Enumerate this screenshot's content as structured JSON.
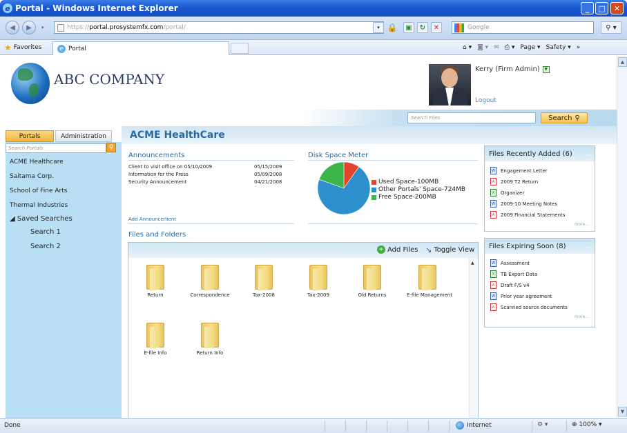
{
  "window": {
    "title": "Portal - Windows Internet Explorer"
  },
  "address": {
    "protocol": "https://",
    "host": "portal.prosystemfx.com",
    "path": "/portal/"
  },
  "search_provider": {
    "placeholder": "Google"
  },
  "favorites": {
    "label": "Favorites",
    "tab_label": "Portal"
  },
  "command_bar": {
    "page": "Page ▾",
    "safety": "Safety ▾"
  },
  "header": {
    "company": "ABC COMPANY",
    "user": "Kerry (Firm Admin)",
    "logout": "Logout",
    "search_placeholder": "Search Files",
    "search_button": "Search"
  },
  "left": {
    "tabs": [
      "Portals",
      "Administration"
    ],
    "search_placeholder": "Search Portals",
    "portals": [
      "ACME Healthcare",
      "Saitama Corp.",
      "School of Fine Arts",
      "Thermal Industries"
    ],
    "saved_label": "Saved Searches",
    "saved": [
      "Search 1",
      "Search 2"
    ]
  },
  "main": {
    "title": "ACME HealthCare",
    "announcements_title": "Announcements",
    "announcements": [
      {
        "text": "Client to visit office on 05/10/2009",
        "date": "05/15/2009"
      },
      {
        "text": "Information for the Press",
        "date": "05/09/2008"
      },
      {
        "text": "Security Announcement",
        "date": "04/21/2008"
      }
    ],
    "add_announcement": "Add Announcement",
    "disk_title": "Disk Space Meter",
    "files_title": "Files and Folders",
    "add_files": "Add Files",
    "toggle_view": "Toggle View",
    "folders": [
      "Return",
      "Correspondence",
      "Tax-2008",
      "Tax-2009",
      "Old Returns",
      "E-file Management",
      "E-file Info",
      "Return Info"
    ]
  },
  "chart_data": {
    "type": "pie",
    "title": "Disk Space Meter",
    "slices": [
      {
        "label": "Used Space-100MB",
        "value": 100,
        "color": "#e3452c"
      },
      {
        "label": "Other Portals' Space-724MB",
        "value": 724,
        "color": "#2e8fcf"
      },
      {
        "label": "Free Space-200MB",
        "value": 200,
        "color": "#3bb54a"
      }
    ]
  },
  "right": {
    "recent_title": "Files Recently Added (6)",
    "recent": [
      {
        "name": "Engagement Letter",
        "type": "word"
      },
      {
        "name": "2009 T2 Return",
        "type": "pdf"
      },
      {
        "name": "Organizer",
        "type": "xls"
      },
      {
        "name": "2009-10 Meeting Notes",
        "type": "word"
      },
      {
        "name": "2009 Financial Statements",
        "type": "pdf"
      }
    ],
    "expiring_title": "Files Expiring Soon (8)",
    "expiring": [
      {
        "name": "Assessment",
        "type": "word"
      },
      {
        "name": "TB Export Data",
        "type": "xls"
      },
      {
        "name": "Draft F/S v4",
        "type": "pdf"
      },
      {
        "name": "Prior year agreement",
        "type": "word"
      },
      {
        "name": "Scanned source documents",
        "type": "pdf"
      }
    ],
    "more": "more..."
  },
  "status": {
    "text": "Done",
    "zone": "Internet",
    "zoom": "100%"
  }
}
